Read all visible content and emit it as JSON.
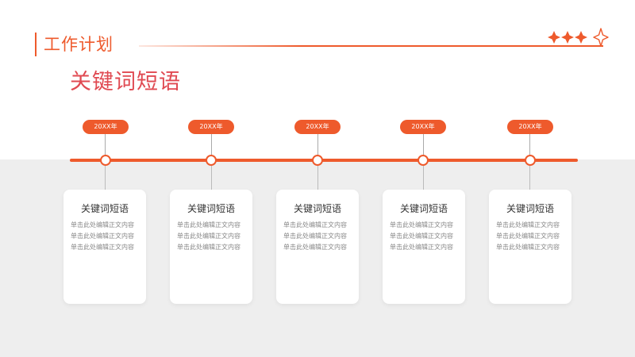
{
  "header": {
    "title": "工作计划"
  },
  "subtitle": "关键词短语",
  "colors": {
    "accent": "#ee5a2c",
    "subtitle": "#e04a52",
    "band": "#eeeeee"
  },
  "decoration": {
    "icon": "stars-decoration-icon"
  },
  "milestones": [
    {
      "year": "20XX年",
      "title": "关键词短语",
      "body": "单击此处编辑正文内容单击此处编辑正文内容单击此处编辑正文内容"
    },
    {
      "year": "20XX年",
      "title": "关键词短语",
      "body": "单击此处编辑正文内容单击此处编辑正文内容单击此处编辑正文内容"
    },
    {
      "year": "20XX年",
      "title": "关键词短语",
      "body": "单击此处编辑正文内容单击此处编辑正文内容单击此处编辑正文内容"
    },
    {
      "year": "20XX年",
      "title": "关键词短语",
      "body": "单击此处编辑正文内容单击此处编辑正文内容单击此处编辑正文内容"
    },
    {
      "year": "20XX年",
      "title": "关键词短语",
      "body": "单击此处编辑正文内容单击此处编辑正文内容单击此处编辑正文内容"
    }
  ]
}
